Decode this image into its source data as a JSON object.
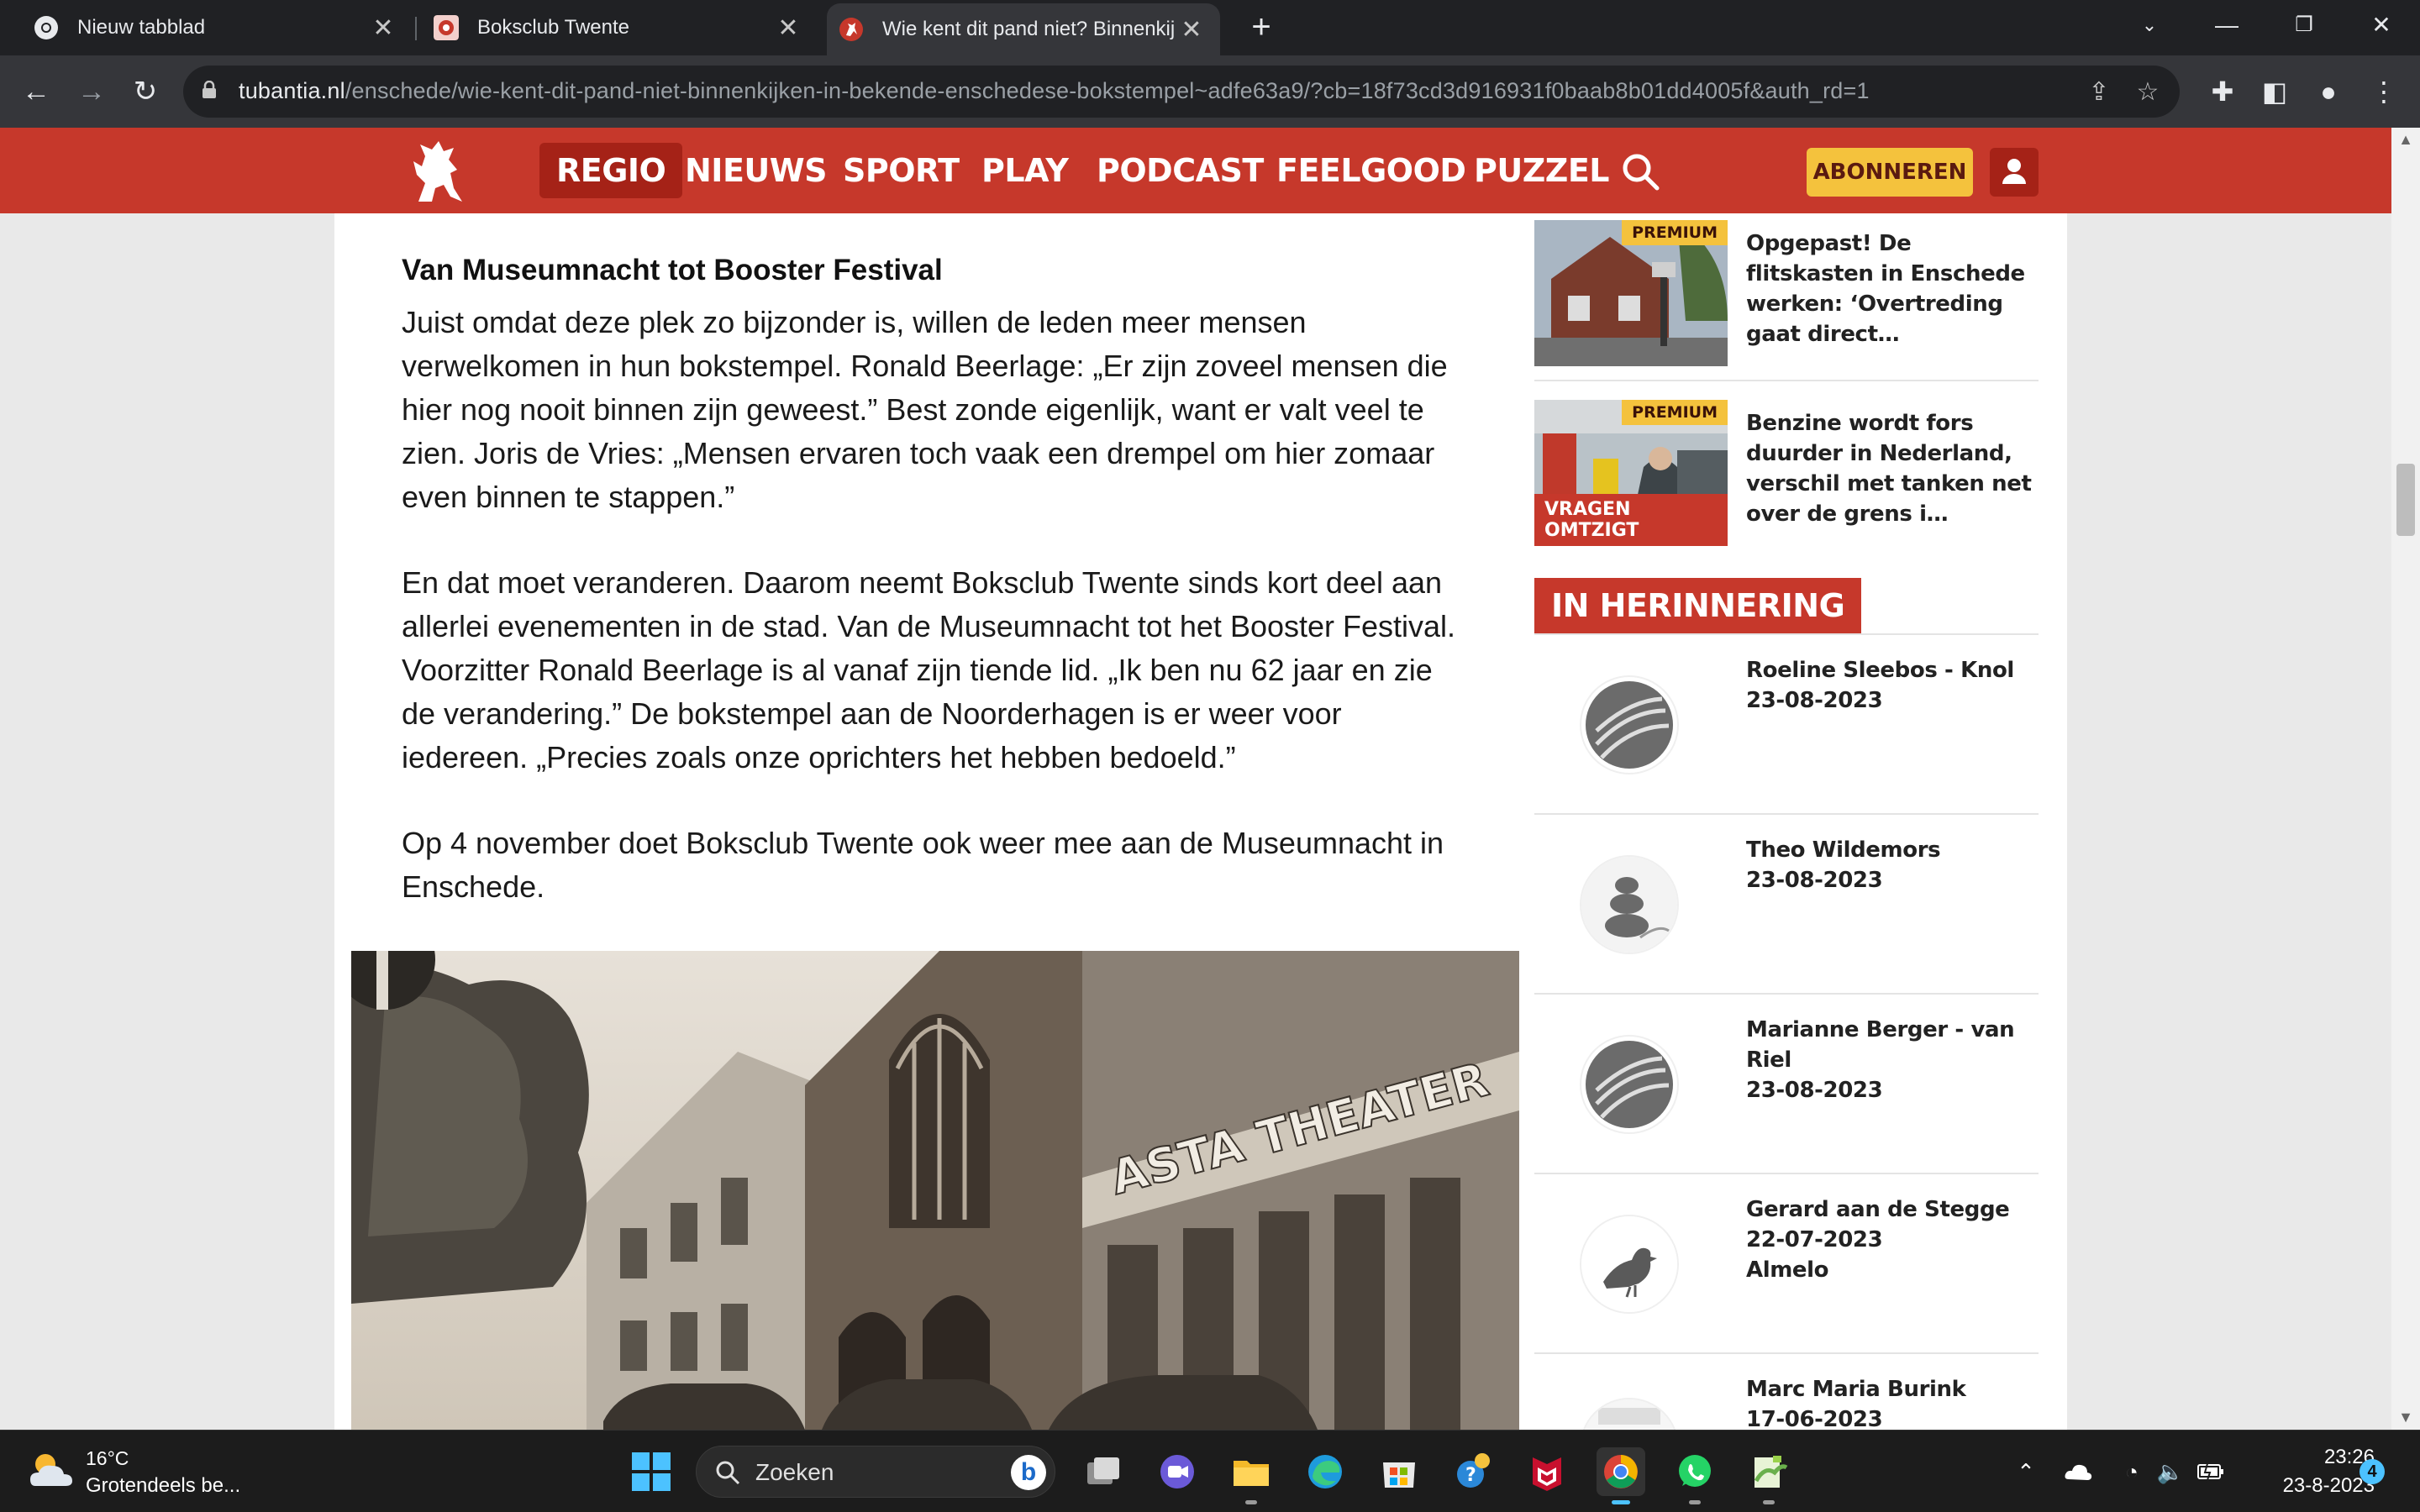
{
  "browser": {
    "tabs": [
      {
        "title": "Nieuw tabblad"
      },
      {
        "title": "Boksclub Twente"
      },
      {
        "title": "Wie kent dit pand niet? Binnenkijken in bekende Enschedese bokstempel"
      }
    ],
    "url_host": "tubantia.nl",
    "url_path": "/enschede/wie-kent-dit-pand-niet-binnenkijken-in-bekende-enschedese-bokstempel~adfe63a9/?cb=18f73cd3d916931f0baab8b01dd4005f&auth_rd=1"
  },
  "site": {
    "brand_color": "#c6382b",
    "nav": [
      "REGIO",
      "NIEUWS",
      "SPORT",
      "PLAY",
      "PODCAST",
      "FEELGOOD",
      "PUZZEL"
    ],
    "subscribe_label": "ABONNEREN"
  },
  "article": {
    "heading": "Van Museumnacht tot Booster Festival",
    "paragraphs": [
      "Juist omdat deze plek zo bijzonder is, willen de leden meer mensen verwelkomen in hun bokstempel. Ronald Beerlage: „Er zijn zoveel mensen die hier nog nooit binnen zijn geweest.” Best zonde eigenlijk, want er valt veel te zien. Joris de Vries: „Mensen ervaren toch vaak een drempel om hier zomaar even binnen te stappen.”",
      "En dat moet veranderen. Daarom neemt Boksclub Twente sinds kort deel aan allerlei evenementen in de stad. Van de Museumnacht tot het Booster Festival. Voorzitter Ronald Beerlage is al vanaf zijn tiende lid. „Ik ben nu 62 jaar en zie de verandering.” De bokstempel aan de Noorderhagen is er weer voor iedereen. „Precies zoals onze oprichters het hebben bedoeld.”",
      "Op 4 november doet Boksclub Twente ook weer mee aan de Museumnacht in Enschede."
    ],
    "photo_sign_text": "ASTA THEATER"
  },
  "sidebar": {
    "news": [
      {
        "badge": "PREMIUM",
        "title": "Opgepast! De flitskasten in Enschede werken: ‘Overtreding gaat direct…"
      },
      {
        "badge": "PREMIUM",
        "label": "VRAGEN OMTZIGT",
        "title": "Benzine wordt fors duurder in Nederland, verschil met tanken net over de grens i…"
      }
    ],
    "section_title": "IN HERINNERING",
    "memorials": [
      {
        "name": "Roeline Sleebos - Knol",
        "date": "23-08-2023",
        "place": ""
      },
      {
        "name": "Theo Wildemors",
        "date": "23-08-2023",
        "place": ""
      },
      {
        "name": "Marianne Berger - van Riel",
        "date": "23-08-2023",
        "place": ""
      },
      {
        "name": "Gerard aan de Stegge",
        "date": "22-07-2023",
        "place": "Almelo"
      },
      {
        "name": "Marc Maria Burink",
        "date": "17-06-2023",
        "place": ""
      }
    ]
  },
  "taskbar": {
    "temperature": "16°C",
    "weather": "Grotendeels be...",
    "search_placeholder": "Zoeken",
    "time": "23:26",
    "date": "23-8-2023",
    "notification_count": "4"
  }
}
